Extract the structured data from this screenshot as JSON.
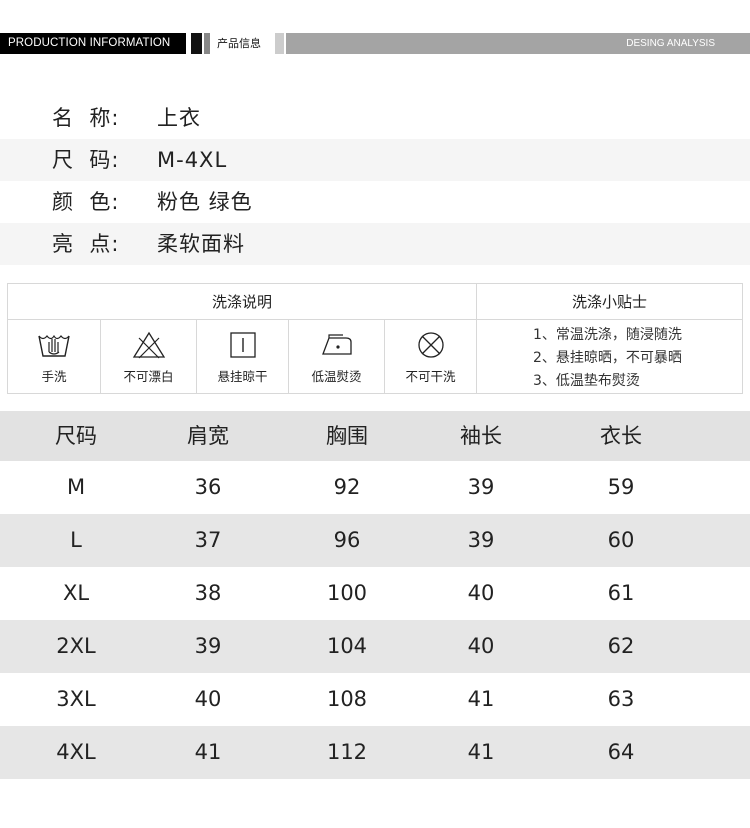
{
  "header": {
    "left_label": "PRODUCTION INFORMATION",
    "center_label": "产品信息",
    "right_label": "DESING ANALYSIS"
  },
  "product_info": [
    {
      "label": "名  称:",
      "value": "上衣"
    },
    {
      "label": "尺  码:",
      "value": "M-4XL"
    },
    {
      "label": "颜  色:",
      "value": "粉色 绿色"
    },
    {
      "label": "亮  点:",
      "value": "柔软面料"
    }
  ],
  "wash": {
    "title": "洗涤说明",
    "tips_title": "洗涤小贴士",
    "icons": [
      {
        "icon": "hand-wash-icon",
        "label": "手洗"
      },
      {
        "icon": "no-bleach-icon",
        "label": "不可漂白"
      },
      {
        "icon": "hang-dry-icon",
        "label": "悬挂晾干"
      },
      {
        "icon": "low-iron-icon",
        "label": "低温熨烫"
      },
      {
        "icon": "no-dry-clean-icon",
        "label": "不可干洗"
      }
    ],
    "tips": [
      "1、常温洗涤，随浸随洗",
      "2、悬挂晾晒，不可暴晒",
      "3、低温垫布熨烫"
    ]
  },
  "size_table": {
    "headers": [
      "尺码",
      "肩宽",
      "胸围",
      "袖长",
      "衣长"
    ],
    "rows": [
      [
        "M",
        "36",
        "92",
        "39",
        "59"
      ],
      [
        "L",
        "37",
        "96",
        "39",
        "60"
      ],
      [
        "XL",
        "38",
        "100",
        "40",
        "61"
      ],
      [
        "2XL",
        "39",
        "104",
        "40",
        "62"
      ],
      [
        "3XL",
        "40",
        "108",
        "41",
        "63"
      ],
      [
        "4XL",
        "41",
        "112",
        "41",
        "64"
      ]
    ]
  }
}
